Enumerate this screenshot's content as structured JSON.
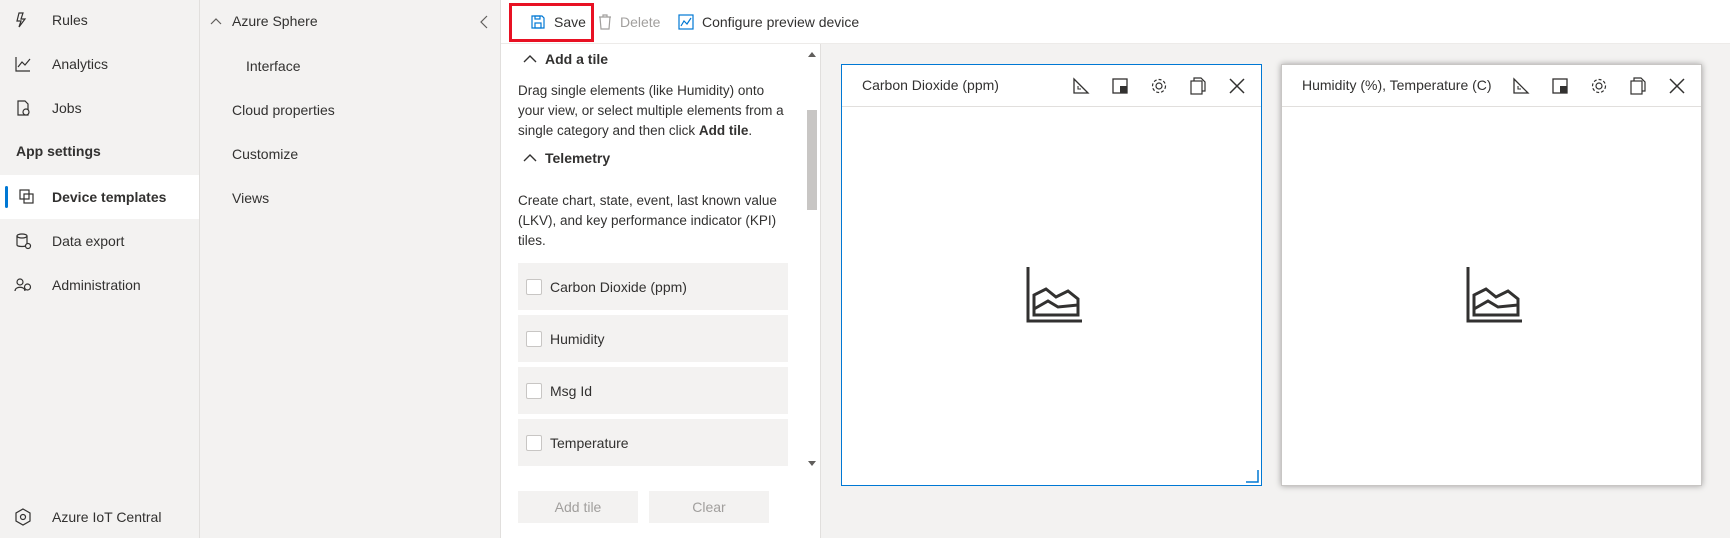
{
  "nav": {
    "items": [
      {
        "label": "Rules",
        "icon": "rules-icon"
      },
      {
        "label": "Analytics",
        "icon": "analytics-icon"
      },
      {
        "label": "Jobs",
        "icon": "jobs-icon"
      },
      {
        "label": "Device templates",
        "icon": "device-templates-icon"
      },
      {
        "label": "Data export",
        "icon": "data-export-icon"
      },
      {
        "label": "Administration",
        "icon": "administration-icon"
      }
    ],
    "section_header": "App settings",
    "footer": "Azure IoT Central"
  },
  "tree": {
    "root": "Azure Sphere",
    "interface": "Interface",
    "cloud_properties": "Cloud properties",
    "customize": "Customize",
    "views": "Views"
  },
  "toolbar": {
    "save": "Save",
    "delete": "Delete",
    "configure": "Configure preview device"
  },
  "panel": {
    "add_tile_title": "Add a tile",
    "add_tile_desc_pre": "Drag single elements (like Humidity) onto your view, or select multiple elements from a single category and then click ",
    "add_tile_desc_bold": "Add tile",
    "add_tile_desc_post": ".",
    "telemetry_title": "Telemetry",
    "telemetry_desc": "Create chart, state, event, last known value (LKV), and key performance indicator (KPI) tiles.",
    "telemetry_items": [
      "Carbon Dioxide (ppm)",
      "Humidity",
      "Msg Id",
      "Temperature"
    ],
    "add_tile_button": "Add tile",
    "clear_button": "Clear"
  },
  "tiles": [
    {
      "title": "Carbon Dioxide (ppm)"
    },
    {
      "title": "Humidity (%), Temperature (C)"
    }
  ],
  "colors": {
    "accent": "#0078d4",
    "highlight": "#e81123",
    "nav_bg": "#f3f2f1"
  }
}
